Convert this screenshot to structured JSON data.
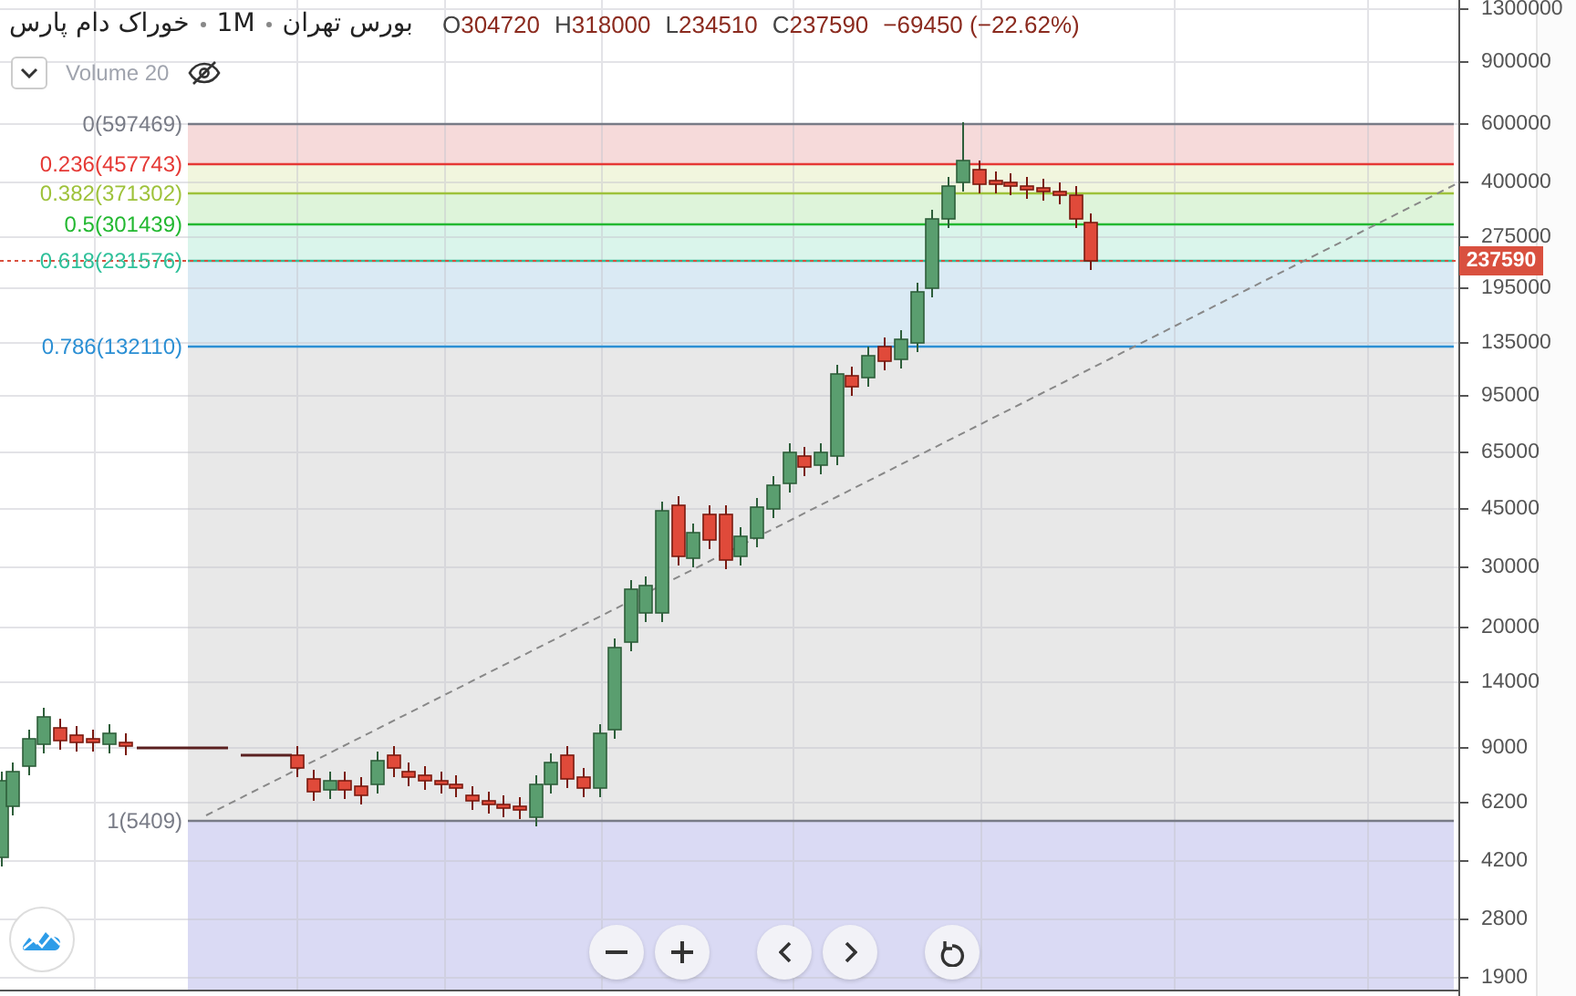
{
  "header": {
    "symbol": "خوراک دام پارس",
    "interval": "1M",
    "exchange": "بورس تهران",
    "ohlc": [
      {
        "label": "O",
        "value": "304720"
      },
      {
        "label": "H",
        "value": "318000"
      },
      {
        "label": "L",
        "value": "234510"
      },
      {
        "label": "C",
        "value": "237590"
      }
    ],
    "change": "−69450 (−22.62%)"
  },
  "indicator": {
    "name": "Volume 20"
  },
  "fib_levels": [
    {
      "label": "0(597469)",
      "color": "#787b86"
    },
    {
      "label": "0.236(457743)",
      "color": "#e53935"
    },
    {
      "label": "0.382(371302)",
      "color": "#9ec23a"
    },
    {
      "label": "0.5(301439)",
      "color": "#22b830"
    },
    {
      "label": "0.618(231576)",
      "color": "#2fc09a"
    },
    {
      "label": "0.786(132110)",
      "color": "#2b8fd4"
    },
    {
      "label": "1(5409)",
      "color": "#787b86"
    }
  ],
  "price_axis": [
    "1300000",
    "900000",
    "600000",
    "400000",
    "275000",
    "195000",
    "135000",
    "95000",
    "65000",
    "45000",
    "30000",
    "20000",
    "14000",
    "9000",
    "6200",
    "4200",
    "2800",
    "1900"
  ],
  "last_price": "237590"
}
